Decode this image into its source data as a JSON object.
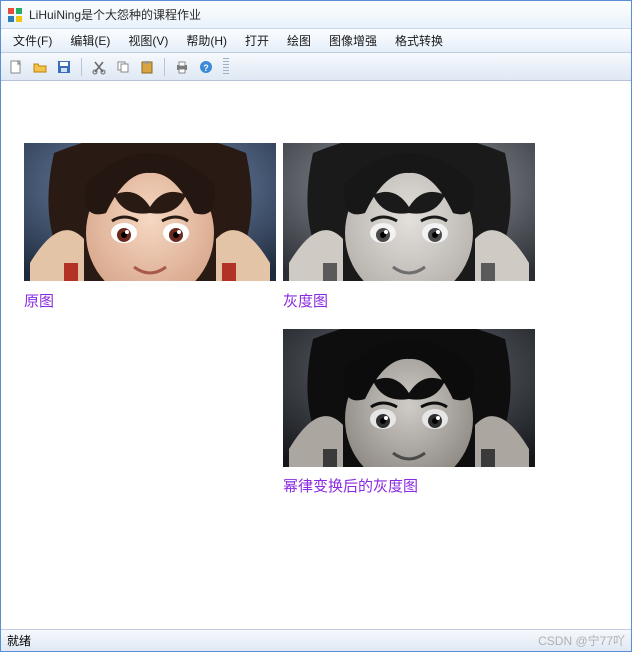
{
  "window": {
    "title": "LiHuiNing是个大怨种的课程作业"
  },
  "menu": {
    "file": "文件(F)",
    "edit": "编辑(E)",
    "view": "视图(V)",
    "help": "帮助(H)",
    "open": "打开",
    "draw": "绘图",
    "enhance": "图像增强",
    "format": "格式转换"
  },
  "toolbar_icons": {
    "new": "new-file-icon",
    "open": "open-folder-icon",
    "save": "save-icon",
    "cut": "cut-icon",
    "copy": "copy-icon",
    "paste": "paste-icon",
    "print": "print-icon",
    "help": "help-icon"
  },
  "images": {
    "original": {
      "label": "原图"
    },
    "grayscale": {
      "label": "灰度图"
    },
    "power_law": {
      "label": "幂律变换后的灰度图"
    }
  },
  "statusbar": {
    "ready": "就绪"
  },
  "watermark": "CSDN @宁77吖"
}
